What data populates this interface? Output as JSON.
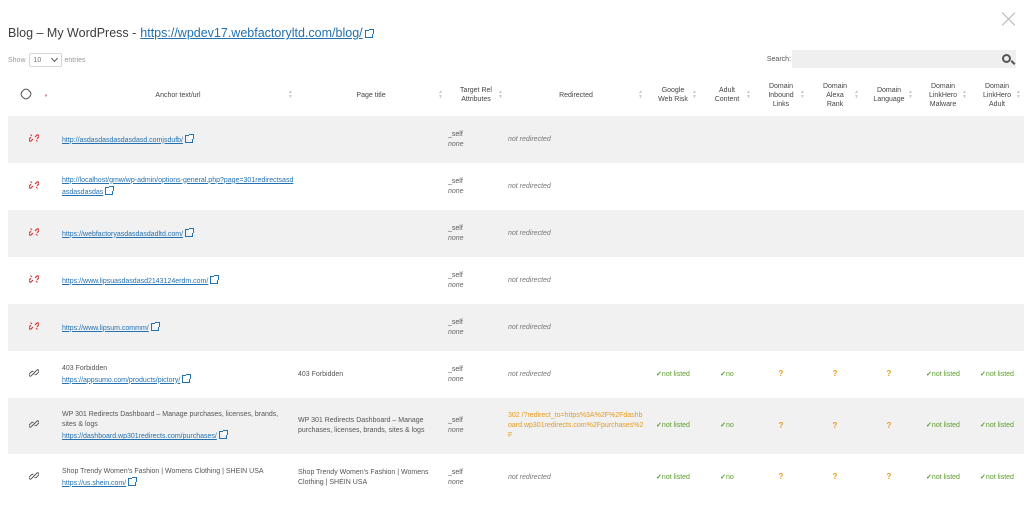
{
  "header": {
    "title": "Blog – My WordPress -",
    "url": "https://wpdev17.webfactoryltd.com/blog/"
  },
  "controls": {
    "show_label": "Show",
    "length_value": "10",
    "entries_label": "entries",
    "search_label": "Search:",
    "search_value": ""
  },
  "columns": {
    "icon": "",
    "star": "*",
    "anchor": "Anchor text/url",
    "page_title": "Page title",
    "target_rel": "Target Rel Attributes",
    "redirected": "Redirected",
    "google": "Google Web Risk",
    "adult": "Adult Content",
    "inbound": "Domain Inbound Links",
    "alexa": "Domain Alexa Rank",
    "language": "Domain Language",
    "linkhero_malware": "Domain LinkHero Malware",
    "linkhero_adult": "Domain LinkHero Adult"
  },
  "colors": {
    "link": "#2271b1",
    "ok": "#4c9a2a",
    "warning": "#e59a1a",
    "broken": "#d63638",
    "row_shade": "#f1f1f1"
  },
  "rows": [
    {
      "status_icon": "broken-link-icon",
      "text": "",
      "url": "http://asdasdasdasdasdasd.comjsdufb/",
      "page_title": "",
      "target": "_self",
      "rel": "none",
      "redirect": "not redirected",
      "code": "",
      "google": "",
      "adult": "",
      "inbound": "",
      "alexa": "",
      "language": "",
      "lh_malware": "",
      "lh_adult": ""
    },
    {
      "status_icon": "broken-link-icon",
      "text": "",
      "url": "http://localhost/gmw/wp-admin/options-general.php?page=301redirectsasdasdasdasdas",
      "page_title": "",
      "target": "_self",
      "rel": "none",
      "redirect": "not redirected",
      "code": "",
      "google": "",
      "adult": "",
      "inbound": "",
      "alexa": "",
      "language": "",
      "lh_malware": "",
      "lh_adult": ""
    },
    {
      "status_icon": "broken-link-icon",
      "text": "",
      "url": "https://webfactoryasdasdasdadltd.com/",
      "page_title": "",
      "target": "_self",
      "rel": "none",
      "redirect": "not redirected",
      "code": "",
      "google": "",
      "adult": "",
      "inbound": "",
      "alexa": "",
      "language": "",
      "lh_malware": "",
      "lh_adult": ""
    },
    {
      "status_icon": "broken-link-icon",
      "text": "",
      "url": "https://www.lipsuasdasdasd2143124erdm.com/",
      "page_title": "",
      "target": "_self",
      "rel": "none",
      "redirect": "not redirected",
      "code": "",
      "google": "",
      "adult": "",
      "inbound": "",
      "alexa": "",
      "language": "",
      "lh_malware": "",
      "lh_adult": ""
    },
    {
      "status_icon": "broken-link-icon",
      "text": "",
      "url": "https://www.lipsum.commm/",
      "page_title": "",
      "target": "_self",
      "rel": "none",
      "redirect": "not redirected",
      "code": "",
      "google": "",
      "adult": "",
      "inbound": "",
      "alexa": "",
      "language": "",
      "lh_malware": "",
      "lh_adult": ""
    },
    {
      "status_icon": "link-icon",
      "text": "403 Forbidden",
      "url": "https://appsumo.com/products/pictory/",
      "page_title": "403 Forbidden",
      "target": "_self",
      "rel": "none",
      "redirect": "not redirected",
      "code": "",
      "google": "not listed",
      "adult": "no",
      "inbound": "?",
      "alexa": "?",
      "language": "?",
      "lh_malware": "not listed",
      "lh_adult": "not listed"
    },
    {
      "status_icon": "link-icon",
      "text": "WP 301 Redirects Dashboard – Manage purchases, licenses, brands, sites & logs",
      "url": "https://dashboard.wp301redirects.com/purchases/",
      "page_title": "WP 301 Redirects Dashboard – Manage purchases, licenses, brands, sites & logs",
      "target": "_self",
      "rel": "none",
      "redirect": "/?redirect_to=https%3A%2F%2Fdashboard.wp301redirects.com%2Fpurchases%2F",
      "code": "302",
      "google": "not listed",
      "adult": "no",
      "inbound": "?",
      "alexa": "?",
      "language": "?",
      "lh_malware": "not listed",
      "lh_adult": "not listed"
    },
    {
      "status_icon": "link-icon",
      "text": "Shop Trendy Women's Fashion | Womens Clothing | SHEIN USA",
      "url": "https://us.shein.com/",
      "page_title": "Shop Trendy Women's Fashion | Womens Clothing | SHEIN USA",
      "target": "_self",
      "rel": "none",
      "redirect": "not redirected",
      "code": "",
      "google": "not listed",
      "adult": "no",
      "inbound": "?",
      "alexa": "?",
      "language": "?",
      "lh_malware": "not listed",
      "lh_adult": "not listed"
    }
  ]
}
